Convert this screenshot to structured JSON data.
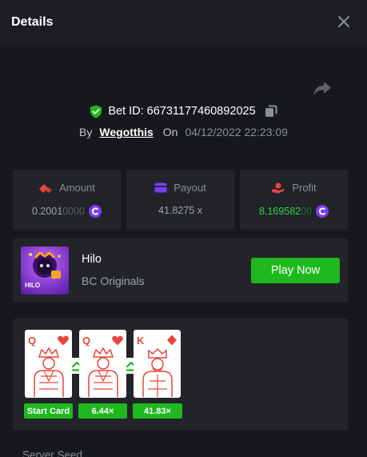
{
  "header": {
    "title": "Details"
  },
  "bet": {
    "id_label": "Bet ID: 66731177460892025",
    "by_label": "By",
    "username": "Wegotthis",
    "on_label": "On",
    "date": "04/12/2022 22:23:09"
  },
  "stats": {
    "amount": {
      "label": "Amount",
      "value_main": "0.2001",
      "value_dim": "0000"
    },
    "payout": {
      "label": "Payout",
      "value": "41.8275 x"
    },
    "profit": {
      "label": "Profit",
      "value_main": "8.169582",
      "value_dim": "00"
    }
  },
  "game": {
    "name": "Hilo",
    "category": "BC Originals",
    "thumb_text": "HILO",
    "play_label": "Play Now"
  },
  "cards": [
    {
      "rank": "Q",
      "suit": "heart",
      "figure": "queen",
      "tag": "Start Card"
    },
    {
      "rank": "Q",
      "suit": "heart",
      "figure": "queen",
      "tag": "6.44×"
    },
    {
      "rank": "K",
      "suit": "diamond",
      "figure": "king",
      "tag": "41.83×"
    }
  ],
  "seed": {
    "label": "Server Seed"
  },
  "colors": {
    "accent_green": "#1fb81f",
    "card_red": "#e8453c",
    "coin_purple": "#7b3ff2",
    "background": "#17181b",
    "panel": "#222429"
  }
}
